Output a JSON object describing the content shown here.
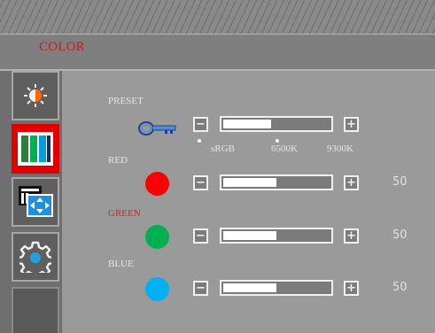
{
  "header": {
    "title": "COLOR"
  },
  "sidebar": {
    "tabs": [
      {
        "name": "brightness",
        "icon": "brightness-sun-icon",
        "active": false
      },
      {
        "name": "color",
        "icon": "color-bars-icon",
        "active": true
      },
      {
        "name": "picture",
        "icon": "picture-position-icon",
        "active": false
      },
      {
        "name": "settings",
        "icon": "gear-icon",
        "active": false
      },
      {
        "name": "blank",
        "icon": "",
        "active": false
      }
    ]
  },
  "preset": {
    "label": "PRESET",
    "icon": "key-icon",
    "options": [
      "sRGB",
      "6500K",
      "9300K"
    ],
    "level": 0.45,
    "minus": "−",
    "plus": "+"
  },
  "channels": [
    {
      "label": "RED",
      "color": "#ff0000",
      "value": "50",
      "level": 0.5,
      "highlight": false
    },
    {
      "label": "GREEN",
      "color": "#00b050",
      "value": "50",
      "level": 0.5,
      "highlight": true
    },
    {
      "label": "BLUE",
      "color": "#00b0f0",
      "value": "50",
      "level": 0.5,
      "highlight": false
    }
  ],
  "colors": {
    "accent": "#e00000",
    "label_active": "#e21d1d"
  }
}
